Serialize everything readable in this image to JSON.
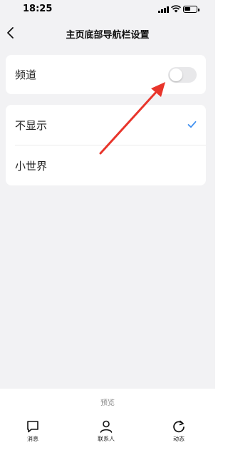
{
  "status_bar": {
    "time": "18:25"
  },
  "header": {
    "title": "主页底部导航栏设置"
  },
  "channel": {
    "label": "频道",
    "toggle_on": false
  },
  "options": [
    {
      "label": "不显示",
      "selected": true
    },
    {
      "label": "小世界",
      "selected": false
    }
  ],
  "bottom": {
    "preview_label": "预览",
    "tabs": [
      {
        "label": "消息",
        "icon": "chat-bubble-icon"
      },
      {
        "label": "联系人",
        "icon": "person-icon"
      },
      {
        "label": "动态",
        "icon": "refresh-icon"
      }
    ]
  },
  "colors": {
    "background": "#f2f2f4",
    "card": "#ffffff",
    "check": "#3d8ef0",
    "annotation_arrow": "#e8352b",
    "toggle_off": "#e8e8ea"
  }
}
